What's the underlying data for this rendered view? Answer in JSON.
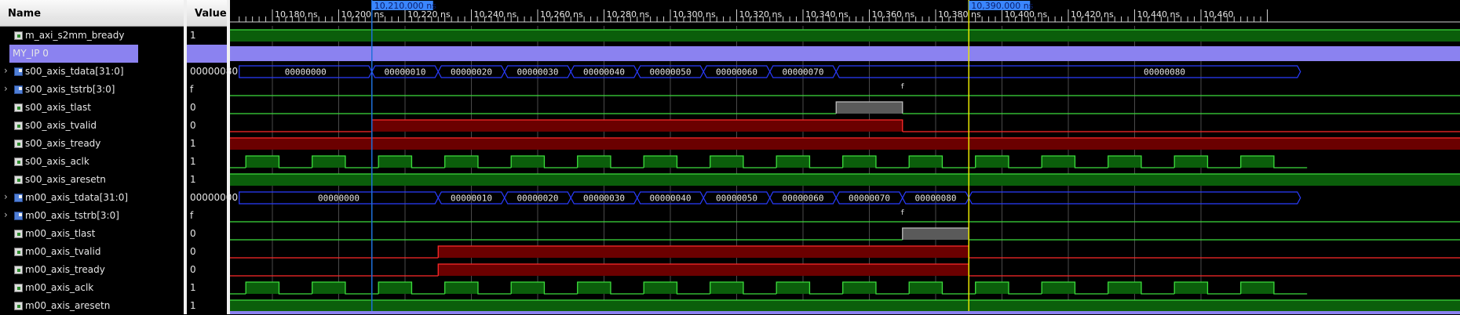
{
  "headers": {
    "name": "Name",
    "value": "Value"
  },
  "timeline": {
    "labels": [
      "10,180 ns",
      "10,200 ns",
      "10,220 ns",
      "10,240 ns",
      "10,260 ns",
      "10,280 ns",
      "10,300 ns",
      "10,320 ns",
      "10,340 ns",
      "10,360 ns",
      "10,380 ns",
      "10,400 ns",
      "10,420 ns",
      "10,440 ns",
      "10,460"
    ]
  },
  "cursors": {
    "blue": "10,210.000 ns",
    "yellow": "10,390.000 ns"
  },
  "signals": [
    {
      "name": "m_axi_s2mm_bready",
      "value": "1",
      "kind": "bit",
      "expandable": false
    },
    {
      "name": "MY_IP 0",
      "value": "",
      "kind": "group",
      "expandable": false
    },
    {
      "name": "s00_axis_tdata[31:0]",
      "value": "00000080",
      "kind": "bus",
      "expandable": true
    },
    {
      "name": "s00_axis_tstrb[3:0]",
      "value": "f",
      "kind": "bus",
      "expandable": true
    },
    {
      "name": "s00_axis_tlast",
      "value": "0",
      "kind": "bit",
      "expandable": false
    },
    {
      "name": "s00_axis_tvalid",
      "value": "0",
      "kind": "bit",
      "expandable": false
    },
    {
      "name": "s00_axis_tready",
      "value": "1",
      "kind": "bit",
      "expandable": false
    },
    {
      "name": "s00_axis_aclk",
      "value": "1",
      "kind": "bit",
      "expandable": false
    },
    {
      "name": "s00_axis_aresetn",
      "value": "1",
      "kind": "bit",
      "expandable": false
    },
    {
      "name": "m00_axis_tdata[31:0]",
      "value": "00000000",
      "kind": "bus",
      "expandable": true
    },
    {
      "name": "m00_axis_tstrb[3:0]",
      "value": "f",
      "kind": "bus",
      "expandable": true
    },
    {
      "name": "m00_axis_tlast",
      "value": "0",
      "kind": "bit",
      "expandable": false
    },
    {
      "name": "m00_axis_tvalid",
      "value": "0",
      "kind": "bit",
      "expandable": false
    },
    {
      "name": "m00_axis_tready",
      "value": "0",
      "kind": "bit",
      "expandable": false
    },
    {
      "name": "m00_axis_aclk",
      "value": "1",
      "kind": "bit",
      "expandable": false
    },
    {
      "name": "m00_axis_aresetn",
      "value": "1",
      "kind": "bit",
      "expandable": false
    }
  ],
  "waves": {
    "s00_tdata": [
      "00000000",
      "00000010",
      "00000020",
      "00000030",
      "00000040",
      "00000050",
      "00000060",
      "00000070",
      "00000080"
    ],
    "s00_tstrb": "f",
    "m00_tdata": [
      "00000000",
      "00000010",
      "00000020",
      "00000030",
      "00000040",
      "00000050",
      "00000060",
      "00000070",
      "00000080"
    ],
    "m00_tstrb": "f"
  },
  "colors": {
    "high_fill": "#0b5e0b",
    "wave_green": "#3ddc3d",
    "bus_blue": "#2a3cff",
    "valid_red": "#6b0000",
    "red_line": "#ff2a2a",
    "group_purple": "#8b82f0",
    "blue_cursor": "#1e6fd9",
    "yellow_cursor": "#e6e600"
  }
}
